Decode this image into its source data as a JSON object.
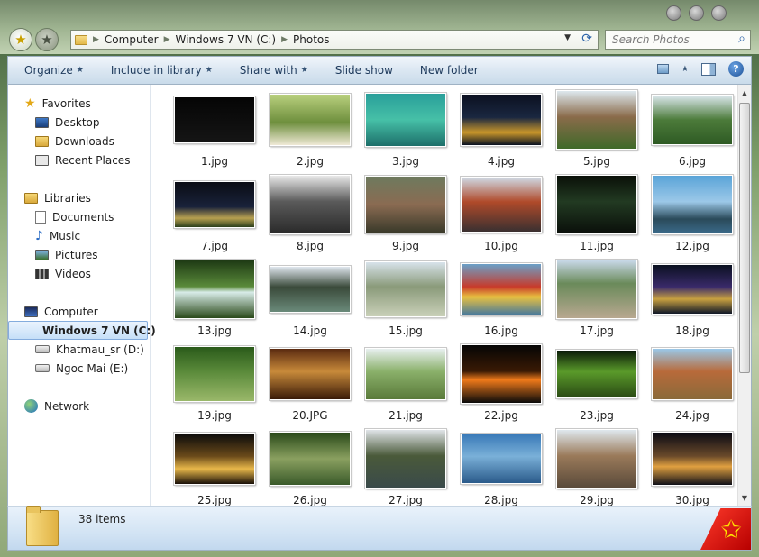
{
  "window": {
    "controls": [
      "minimize",
      "maximize",
      "close"
    ]
  },
  "address": {
    "path": [
      "Computer",
      "Windows 7 VN (C:)",
      "Photos"
    ]
  },
  "search": {
    "placeholder": "Search Photos"
  },
  "toolbar": {
    "organize": "Organize",
    "include_library": "Include in library",
    "share_with": "Share with",
    "slide_show": "Slide show",
    "new_folder": "New folder",
    "dropdown_glyph": "★"
  },
  "nav": {
    "favorites": "Favorites",
    "desktop": "Desktop",
    "downloads": "Downloads",
    "recent_places": "Recent Places",
    "libraries": "Libraries",
    "documents": "Documents",
    "music": "Music",
    "pictures": "Pictures",
    "videos": "Videos",
    "computer": "Computer",
    "drive_c": "Windows 7 VN (C:)",
    "drive_d": "Khatmau_sr (D:)",
    "drive_e": "Ngoc Mai (E:)",
    "network": "Network"
  },
  "files": [
    {
      "name": "1.jpg",
      "w": 90,
      "h": 52,
      "c": "#050505 0%, #151515 100%"
    },
    {
      "name": "2.jpg",
      "w": 90,
      "h": 58,
      "c": "#b8cf7d 0%, #6e8f3d 55%, #efe9d6 100%"
    },
    {
      "name": "3.jpg",
      "w": 90,
      "h": 60,
      "c": "#2a9f9a 0%, #46c0a7 50%, #1d6f6a 100%"
    },
    {
      "name": "4.jpg",
      "w": 90,
      "h": 58,
      "c": "#0b1020 0%, #1a2740 45%, #c9962a 75%, #091222 100%"
    },
    {
      "name": "5.jpg",
      "w": 90,
      "h": 66,
      "c": "#dde8ee 0%, #8a6b4a 45%, #3f6a2a 100%"
    },
    {
      "name": "6.jpg",
      "w": 90,
      "h": 56,
      "c": "#dbe7ec 0%, #4c7b3a 50%, #2e5a24 100%"
    },
    {
      "name": "7.jpg",
      "w": 90,
      "h": 52,
      "c": "#0a0c14 0%, #19223a 55%, #b7a050 80%, #2b3f1c 100%"
    },
    {
      "name": "8.jpg",
      "w": 90,
      "h": 66,
      "c": "#e8e8e8 0%, #5a5a5a 45%, #2a2a2a 100%"
    },
    {
      "name": "9.jpg",
      "w": 90,
      "h": 64,
      "c": "#6e7a5e 0%, #8a6b52 50%, #3a3a2a 100%"
    },
    {
      "name": "10.jpg",
      "w": 90,
      "h": 62,
      "c": "#cfd9e4 0%, #b04a2a 45%, #3a3030 100%"
    },
    {
      "name": "11.jpg",
      "w": 90,
      "h": 66,
      "c": "#0a1008 0%, #223a22 45%, #0a0f0a 100%"
    },
    {
      "name": "12.jpg",
      "w": 90,
      "h": 66,
      "c": "#5aa4d8 0%, #9cc8e8 45%, #2a4a5a 75%, #3a6a8a 100%"
    },
    {
      "name": "13.jpg",
      "w": 90,
      "h": 66,
      "c": "#1e3a14 0%, #5a8a3a 45%, #d8ece8 55%, #2a4a1a 100%"
    },
    {
      "name": "14.jpg",
      "w": 90,
      "h": 52,
      "c": "#dfe6ee 0%, #3a4a3a 45%, #6a8a7a 100%"
    },
    {
      "name": "15.jpg",
      "w": 90,
      "h": 62,
      "c": "#d7e2ea 0%, #8a9a7a 45%, #c9d0b8 100%"
    },
    {
      "name": "16.jpg",
      "w": 90,
      "h": 58,
      "c": "#6aa0c8 0%, #c83a2a 45%, #e8c040 65%, #4a7a9a 100%"
    },
    {
      "name": "17.jpg",
      "w": 90,
      "h": 66,
      "c": "#c8d8e8 0%, #6a8a5a 40%, #b8a890 100%"
    },
    {
      "name": "18.jpg",
      "w": 90,
      "h": 56,
      "c": "#0a1020 0%, #3a2a6a 45%, #c8a040 70%, #101828 100%"
    },
    {
      "name": "19.jpg",
      "w": 90,
      "h": 62,
      "c": "#2a5a1a 0%, #5a8a3a 45%, #9ab86a 100%"
    },
    {
      "name": "20.JPG",
      "w": 90,
      "h": 58,
      "c": "#5a2a10 0%, #c88a3a 45%, #3a1a08 100%"
    },
    {
      "name": "21.jpg",
      "w": 90,
      "h": 58,
      "c": "#e8f0f0 0%, #8ab06a 45%, #5a7a3a 100%"
    },
    {
      "name": "22.jpg",
      "w": 90,
      "h": 66,
      "c": "#050505 0%, #3a1a05 45%, #f07a1a 60%, #0a0a0a 100%"
    },
    {
      "name": "23.jpg",
      "w": 90,
      "h": 54,
      "c": "#0a1a08 0%, #5a9a2a 45%, #2a4a14 100%"
    },
    {
      "name": "24.jpg",
      "w": 90,
      "h": 58,
      "c": "#9ac8e8 0%, #b86a3a 45%, #8a6a3a 100%"
    },
    {
      "name": "25.jpg",
      "w": 90,
      "h": 58,
      "c": "#0a0a0a 0%, #6a4a1a 45%, #e8b84a 70%, #1a1008 100%"
    },
    {
      "name": "26.jpg",
      "w": 90,
      "h": 60,
      "c": "#2a4a1a 0%, #8aa060 50%, #3a5a2a 100%"
    },
    {
      "name": "27.jpg",
      "w": 90,
      "h": 66,
      "c": "#e0e4e8 0%, #4a5a3a 45%, #3a4a4a 100%"
    },
    {
      "name": "28.jpg",
      "w": 90,
      "h": 56,
      "c": "#3a7ab8 0%, #7ab0d8 45%, #2a5a8a 100%"
    },
    {
      "name": "29.jpg",
      "w": 90,
      "h": 66,
      "c": "#dfe8ee 0%, #9a7a5a 45%, #5a4a3a 100%"
    },
    {
      "name": "30.jpg",
      "w": 90,
      "h": 60,
      "c": "#0a0a14 0%, #6a4a2a 45%, #e0a040 65%, #101018 100%"
    }
  ],
  "status": {
    "count": "38 items"
  },
  "colors": {
    "accent": "#3f6fc0",
    "selection": "#c5dff8"
  }
}
